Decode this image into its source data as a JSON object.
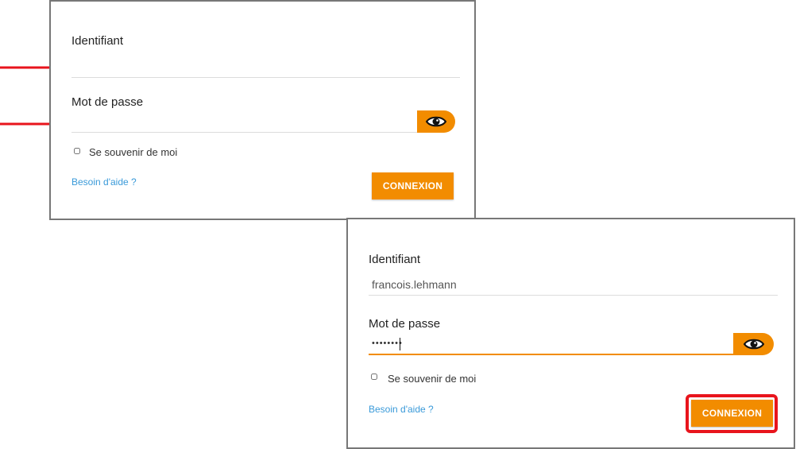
{
  "colors": {
    "accent": "#f28c00",
    "link": "#3a9ad9",
    "highlight": "#e8141c",
    "arrow": "#e8141c"
  },
  "empty_form": {
    "identifier_label": "Identifiant",
    "identifier_value": "",
    "password_label": "Mot de passe",
    "password_value": "",
    "show_password_icon": "eye-icon",
    "remember_label": "Se souvenir de moi",
    "remember_checked": false,
    "help_link": "Besoin d'aide ?",
    "login_button": "CONNEXION"
  },
  "filled_form": {
    "identifier_label": "Identifiant",
    "identifier_value": "francois.lehmann",
    "password_label": "Mot de passe",
    "password_value": "••••••••",
    "show_password_icon": "eye-icon",
    "remember_label": "Se souvenir de moi",
    "remember_checked": false,
    "help_link": "Besoin d'aide ?",
    "login_button": "CONNEXION"
  },
  "annotations": {
    "arrow_icon": "red-arrow-icon",
    "highlight": "red-highlight-box"
  }
}
